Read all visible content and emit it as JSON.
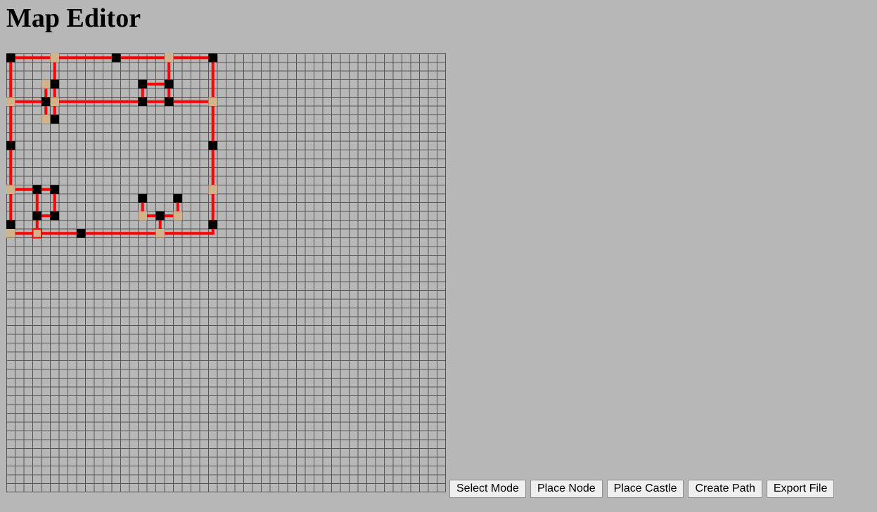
{
  "title": "Map Editor",
  "toolbar": {
    "select_mode": "Select Mode",
    "place_node": "Place Node",
    "place_castle": "Place Castle",
    "create_path": "Create Path",
    "export_file": "Export File"
  },
  "grid": {
    "columns": 50,
    "rows": 50
  },
  "colors": {
    "background": "#b7b7b7",
    "grid_line": "#555555",
    "path": "#ff0000",
    "node": "#000000",
    "castle": "#d2b48c",
    "selected_outline": "#ff0000"
  },
  "map": {
    "nodes": [
      [
        0,
        0
      ],
      [
        12,
        0
      ],
      [
        23,
        0
      ],
      [
        5,
        3
      ],
      [
        15,
        3
      ],
      [
        18,
        3
      ],
      [
        4,
        5
      ],
      [
        15,
        5
      ],
      [
        18,
        5
      ],
      [
        5,
        7
      ],
      [
        0,
        10
      ],
      [
        23,
        10
      ],
      [
        3,
        15
      ],
      [
        5,
        15
      ],
      [
        15,
        16
      ],
      [
        19,
        16
      ],
      [
        3,
        18
      ],
      [
        5,
        18
      ],
      [
        17,
        18
      ],
      [
        0,
        19
      ],
      [
        23,
        19
      ],
      [
        8,
        20
      ]
    ],
    "castles": [
      [
        5,
        0
      ],
      [
        18,
        0
      ],
      [
        4,
        3
      ],
      [
        0,
        5
      ],
      [
        5,
        5
      ],
      [
        23,
        5
      ],
      [
        4,
        7
      ],
      [
        0,
        15
      ],
      [
        23,
        15
      ],
      [
        15,
        18
      ],
      [
        19,
        18
      ],
      [
        0,
        20
      ],
      [
        3,
        20
      ],
      [
        17,
        20
      ]
    ],
    "selected": [
      3,
      20
    ],
    "paths": [
      [
        [
          0,
          0
        ],
        [
          23,
          0
        ]
      ],
      [
        [
          0,
          0
        ],
        [
          0,
          20
        ]
      ],
      [
        [
          23,
          0
        ],
        [
          23,
          20
        ]
      ],
      [
        [
          0,
          20
        ],
        [
          23,
          20
        ]
      ],
      [
        [
          5,
          0
        ],
        [
          5,
          7
        ]
      ],
      [
        [
          4,
          3
        ],
        [
          5,
          3
        ]
      ],
      [
        [
          4,
          3
        ],
        [
          4,
          7
        ]
      ],
      [
        [
          0,
          5
        ],
        [
          23,
          5
        ]
      ],
      [
        [
          18,
          0
        ],
        [
          18,
          5
        ]
      ],
      [
        [
          15,
          3
        ],
        [
          18,
          3
        ]
      ],
      [
        [
          15,
          3
        ],
        [
          15,
          5
        ]
      ],
      [
        [
          0,
          15
        ],
        [
          5,
          15
        ]
      ],
      [
        [
          3,
          15
        ],
        [
          3,
          20
        ]
      ],
      [
        [
          5,
          15
        ],
        [
          5,
          18
        ]
      ],
      [
        [
          3,
          18
        ],
        [
          5,
          18
        ]
      ],
      [
        [
          15,
          16
        ],
        [
          15,
          18
        ]
      ],
      [
        [
          19,
          16
        ],
        [
          19,
          18
        ]
      ],
      [
        [
          15,
          18
        ],
        [
          19,
          18
        ]
      ],
      [
        [
          17,
          18
        ],
        [
          17,
          20
        ]
      ]
    ]
  }
}
